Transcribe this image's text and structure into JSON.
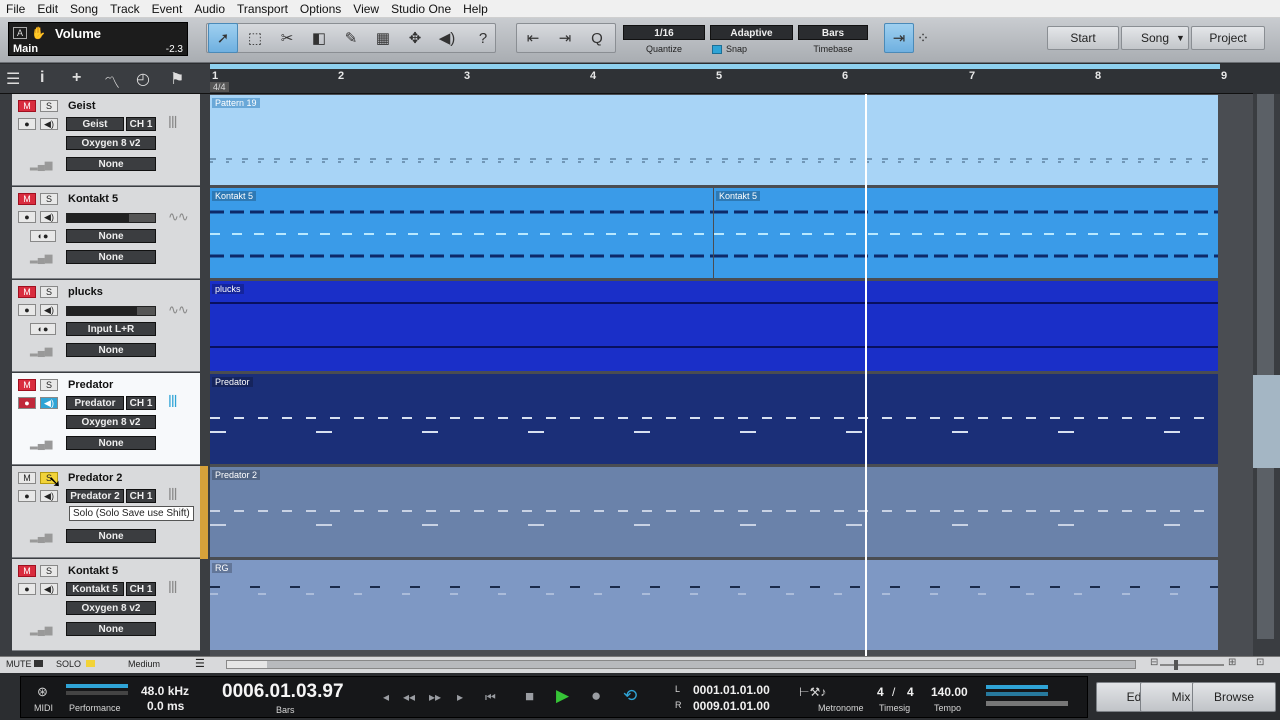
{
  "menu": [
    "File",
    "Edit",
    "Song",
    "Track",
    "Event",
    "Audio",
    "Transport",
    "Options",
    "View",
    "Studio One",
    "Help"
  ],
  "volume": {
    "letter": "A",
    "title": "Volume",
    "target": "Main",
    "value": "-2.3"
  },
  "quantize": {
    "value": "1/16",
    "label": "Quantize"
  },
  "snap": {
    "value": "Adaptive",
    "label": "Snap"
  },
  "timebase": {
    "value": "Bars",
    "label": "Timebase"
  },
  "pages": {
    "start": "Start",
    "song": "Song",
    "project": "Project"
  },
  "ruler": {
    "bars": [
      "1",
      "2",
      "3",
      "4",
      "5",
      "6",
      "7",
      "8",
      "9"
    ],
    "timesig": "4/4"
  },
  "tracks": [
    {
      "name": "Geist",
      "m": "M",
      "s": "S",
      "inst": "Geist",
      "ch": "CH 1",
      "out": "Oxygen 8 v2",
      "auto": "None"
    },
    {
      "name": "Kontakt 5",
      "m": "M",
      "s": "S",
      "input": "None",
      "auto": "None"
    },
    {
      "name": "plucks",
      "m": "M",
      "s": "S",
      "input": "Input L+R",
      "auto": "None"
    },
    {
      "name": "Predator",
      "m": "M",
      "s": "S",
      "inst": "Predator",
      "ch": "CH 1",
      "out": "Oxygen 8 v2",
      "auto": "None"
    },
    {
      "name": "Predator 2",
      "m": "M",
      "s": "S",
      "inst": "Predator 2",
      "ch": "CH 1",
      "auto": "None"
    },
    {
      "name": "Kontakt 5",
      "m": "M",
      "s": "S",
      "inst": "Kontakt 5",
      "ch": "CH 1",
      "out": "Oxygen 8 v2",
      "auto": "None"
    }
  ],
  "tooltip": "Solo (Solo Save use Shift)",
  "regions": [
    "Pattern 19",
    "Kontakt 5",
    "Kontakt 5",
    "plucks",
    "Predator",
    "Predator 2",
    "RG"
  ],
  "bottom": {
    "mute": "MUTE",
    "solo": "SOLO",
    "size": "Medium"
  },
  "transport": {
    "midi": "MIDI",
    "performance": "Performance",
    "samplerate": "48.0 kHz",
    "latency": "0.0 ms",
    "position": "0006.01.03.97",
    "pos_unit": "Bars",
    "loop_l": "L",
    "loop_start": "0001.01.01.00",
    "loop_r": "R",
    "loop_end": "0009.01.01.00",
    "metronome": "Metronome",
    "timesig_n": "4",
    "timesig_slash": "/",
    "timesig_d": "4",
    "timesig_label": "Timesig",
    "tempo": "140.00",
    "tempo_label": "Tempo"
  },
  "views": {
    "edit": "Edit",
    "mix": "Mix",
    "browse": "Browse"
  },
  "colors": {
    "accent": "#2fa4d6",
    "mute": "#d92c3e",
    "solo": "#f2d338",
    "playhead": "#ffffff"
  }
}
